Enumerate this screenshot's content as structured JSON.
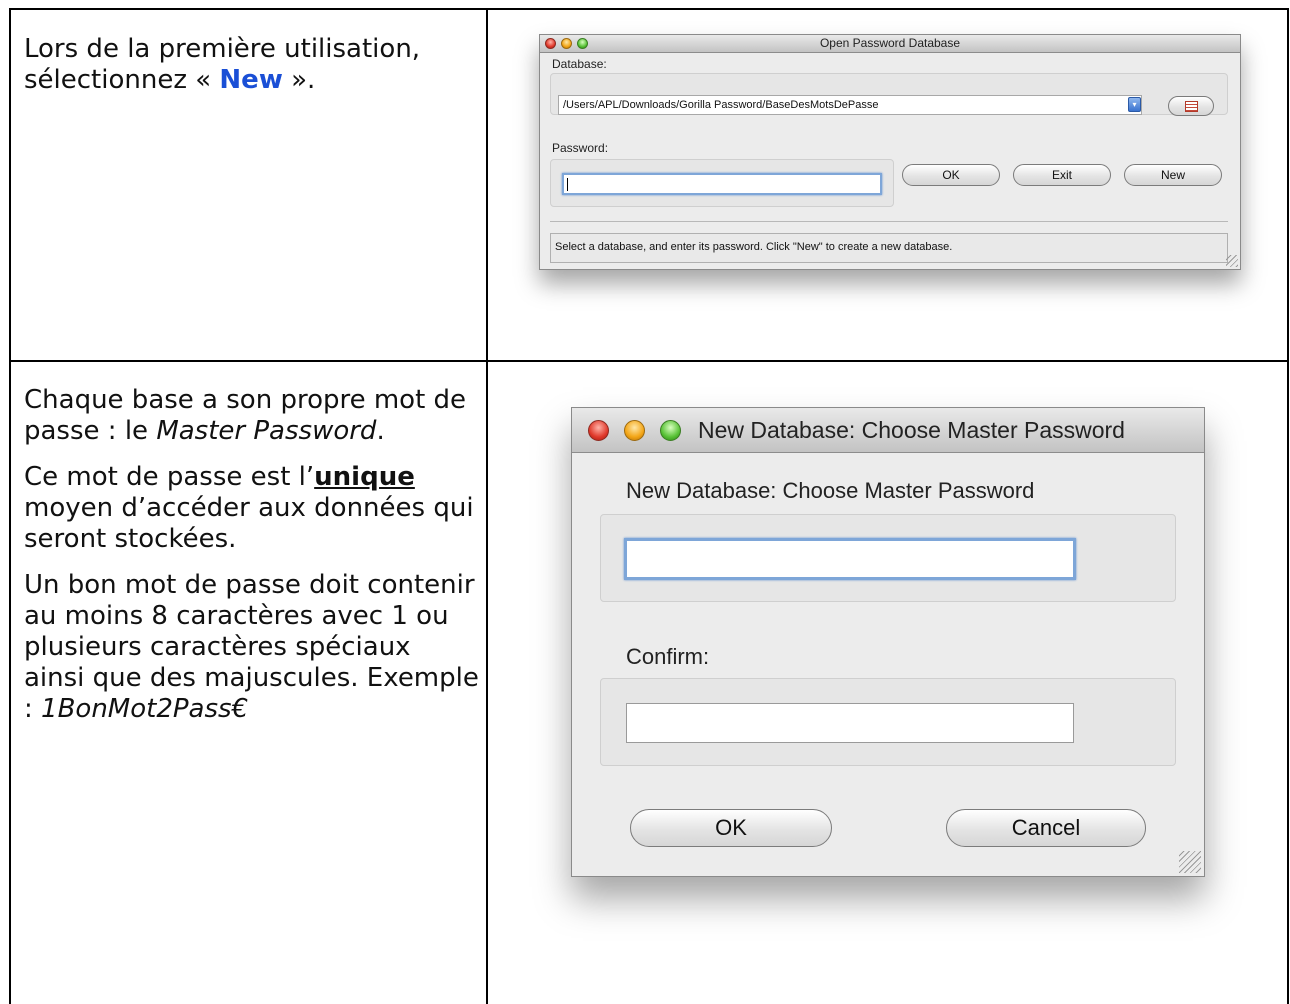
{
  "row1": {
    "instruction_before": "Lors de la première utilisation, sélectionnez « ",
    "instruction_highlight": "New",
    "instruction_after": " ».",
    "dialog": {
      "title": "Open Password Database",
      "database_label": "Database:",
      "database_path": "/Users/APL/Downloads/Gorilla Password/BaseDesMotsDePasse",
      "password_label": "Password:",
      "password_value": "",
      "ok_label": "OK",
      "exit_label": "Exit",
      "new_label": "New",
      "status_text": "Select a database, and enter its password. Click \"New\" to create a new database."
    }
  },
  "row2": {
    "p1_before": "Chaque base a son propre mot de passe : le ",
    "p1_italic": "Master Password",
    "p1_after": ".",
    "p2_before": "Ce mot de passe est l’",
    "p2_underlined": "unique ",
    "p2_after": "moyen d’accéder aux données qui seront stockées.",
    "p3_text": "Un bon mot de passe doit contenir au moins 8 caractères avec 1 ou plusieurs caractères spéciaux ainsi que des majuscules. Exemple : ",
    "p3_example": "1BonMot2Pass€",
    "dialog": {
      "title": "New Database: Choose Master Password",
      "heading": "New Database: Choose Master Password",
      "password_value": "",
      "confirm_label": "Confirm:",
      "confirm_value": "",
      "ok_label": "OK",
      "cancel_label": "Cancel"
    }
  }
}
